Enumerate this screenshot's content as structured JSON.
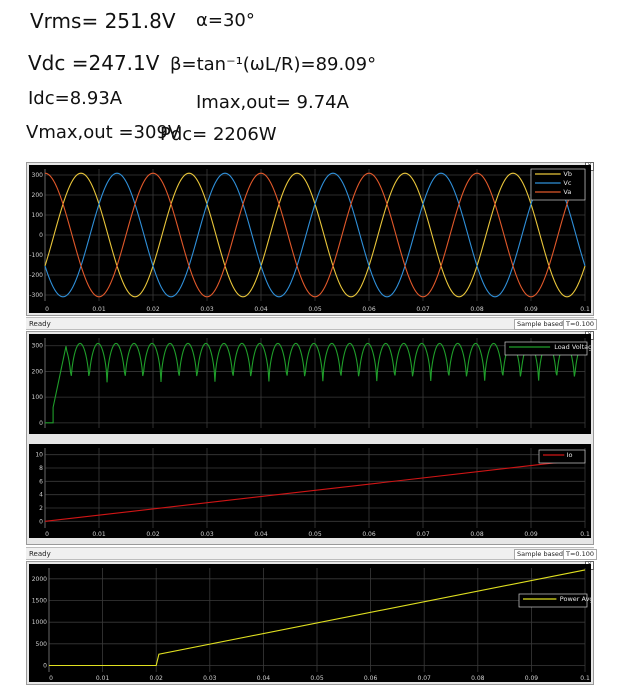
{
  "notes": {
    "vrms": "Vrms= 251.8V",
    "alpha": "α=30°",
    "vdc": "Vdc =247.1V",
    "beta": "β=tan⁻¹(ωL/R)=89.09°",
    "idc": "Idc=8.93A",
    "imax": "Imax,out= 9.74A",
    "vmax": "Vmax,out =309V",
    "pdc": "Pdc= 2206W"
  },
  "status1": {
    "ready": "Ready",
    "mode": "Sample based",
    "time": "T=0.100"
  },
  "status2": {
    "ready": "Ready",
    "mode": "Sample based",
    "time": "T=0.100"
  },
  "xticks": [
    "0",
    "0.01",
    "0.02",
    "0.03",
    "0.04",
    "0.05",
    "0.06",
    "0.07",
    "0.08",
    "0.09",
    "0.1"
  ],
  "colors": {
    "va": "#e0582a",
    "vb": "#e8c53a",
    "vc": "#2f8fd8",
    "load": "#1f9e2a",
    "io": "#d01515",
    "pavg": "#e0e020",
    "grid": "#3a3a3a",
    "bg": "#000000"
  },
  "chart_data": [
    {
      "type": "line",
      "name": "three-phase-source",
      "x": [
        0,
        0.1
      ],
      "yticks": [
        "300",
        "200",
        "100",
        "0",
        "-100",
        "-200",
        "-300"
      ],
      "ylim": [
        -330,
        330
      ],
      "series": [
        {
          "name": "Vb",
          "amplitude": 309,
          "frequency_hz": 50,
          "phase_deg": -120
        },
        {
          "name": "Vc",
          "amplitude": 309,
          "frequency_hz": 50,
          "phase_deg": 120
        },
        {
          "name": "Va",
          "amplitude": 309,
          "frequency_hz": 50,
          "phase_deg": 0
        }
      ],
      "legend": [
        "Vb",
        "Vc",
        "Va"
      ],
      "legend_position": "top-right"
    },
    {
      "type": "line",
      "name": "load-voltage",
      "yticks": [
        "300",
        "200",
        "100",
        "0"
      ],
      "ylim": [
        -20,
        330
      ],
      "series": [
        {
          "name": "Load Voltage",
          "peak": 309,
          "trough": 155,
          "ripple_period_s": 0.00333
        }
      ],
      "legend": [
        "Load Voltage"
      ],
      "legend_position": "top-right"
    },
    {
      "type": "line",
      "name": "output-current",
      "yticks": [
        "10",
        "8",
        "6",
        "4",
        "2",
        "0"
      ],
      "ylim": [
        -1,
        11
      ],
      "series": [
        {
          "name": "Io",
          "x": [
            0,
            0.1
          ],
          "y": [
            0,
            9.3
          ]
        }
      ],
      "legend": [
        "Io"
      ],
      "legend_position": "top-right"
    },
    {
      "type": "line",
      "name": "average-power",
      "yticks": [
        "2000",
        "1500",
        "1000",
        "500",
        "0"
      ],
      "ylim": [
        -150,
        2250
      ],
      "series": [
        {
          "name": "Power Avg",
          "x": [
            0,
            0.02,
            0.0205,
            0.1
          ],
          "y": [
            0,
            0,
            260,
            2206
          ]
        }
      ],
      "legend": [
        "Power Avg"
      ],
      "legend_position": "top-right"
    }
  ]
}
